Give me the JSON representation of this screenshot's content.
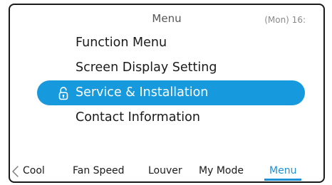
{
  "header": {
    "title": "Menu",
    "clock": "(Mon) 16:"
  },
  "menu": {
    "items": [
      {
        "label": "Function Menu",
        "selected": false
      },
      {
        "label": "Screen Display Setting",
        "selected": false
      },
      {
        "label": "Service & Installation",
        "selected": true,
        "icon": "lock-icon"
      },
      {
        "label": "Contact Information",
        "selected": false
      }
    ]
  },
  "tabs": {
    "back_icon": "chevron-left-icon",
    "items": [
      {
        "label": "Cool",
        "active": false
      },
      {
        "label": "Fan Speed",
        "active": false
      },
      {
        "label": "Louver",
        "active": false
      },
      {
        "label": "My Mode",
        "active": false
      },
      {
        "label": "Menu",
        "active": true
      }
    ]
  },
  "colors": {
    "selection": "#1799dd",
    "active_tab": "#1e90d6",
    "frame": "#1a1a1a"
  }
}
